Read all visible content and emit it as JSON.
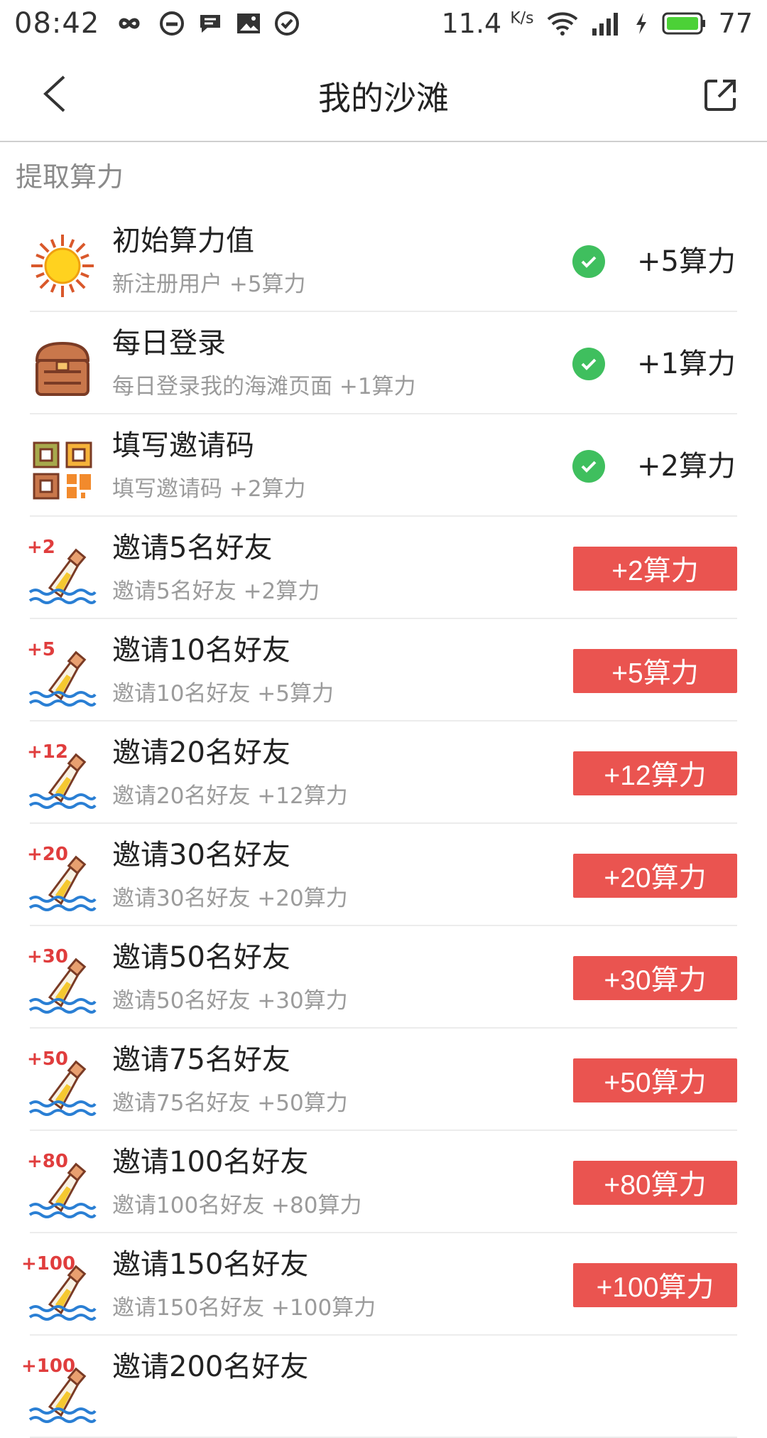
{
  "status_bar": {
    "time": "08:42",
    "speed": "11.4",
    "speed_unit": "K/s",
    "battery": "77",
    "icons": [
      "infinity-icon",
      "face-icon",
      "message-icon",
      "image-icon",
      "check-circle-icon",
      "wifi-icon",
      "signal-icon",
      "charging-icon",
      "battery-icon"
    ]
  },
  "appbar": {
    "title": "我的沙滩"
  },
  "section_title": "提取算力",
  "colors": {
    "accent": "#ea5450",
    "check": "#3fbf5e"
  },
  "items": [
    {
      "icon": "sun-icon",
      "name": "初始算力值",
      "desc": "新注册用户 +5算力",
      "value": "+5算力",
      "status": "done"
    },
    {
      "icon": "treasure-chest-icon",
      "name": "每日登录",
      "desc": "每日登录我的海滩页面 +1算力",
      "value": "+1算力",
      "status": "done"
    },
    {
      "icon": "qr-code-icon",
      "name": "填写邀请码",
      "desc": "填写邀请码 +2算力",
      "value": "+2算力",
      "status": "done"
    },
    {
      "icon": "bottle-icon",
      "badge": "+2",
      "name": "邀请5名好友",
      "desc": "邀请5名好友 +2算力",
      "value": "+2算力",
      "status": "claim"
    },
    {
      "icon": "bottle-icon",
      "badge": "+5",
      "name": "邀请10名好友",
      "desc": "邀请10名好友 +5算力",
      "value": "+5算力",
      "status": "claim"
    },
    {
      "icon": "bottle-icon",
      "badge": "+12",
      "name": "邀请20名好友",
      "desc": "邀请20名好友 +12算力",
      "value": "+12算力",
      "status": "claim"
    },
    {
      "icon": "bottle-icon",
      "badge": "+20",
      "name": "邀请30名好友",
      "desc": "邀请30名好友 +20算力",
      "value": "+20算力",
      "status": "claim"
    },
    {
      "icon": "bottle-icon",
      "badge": "+30",
      "name": "邀请50名好友",
      "desc": "邀请50名好友 +30算力",
      "value": "+30算力",
      "status": "claim"
    },
    {
      "icon": "bottle-icon",
      "badge": "+50",
      "name": "邀请75名好友",
      "desc": "邀请75名好友 +50算力",
      "value": "+50算力",
      "status": "claim"
    },
    {
      "icon": "bottle-icon",
      "badge": "+80",
      "name": "邀请100名好友",
      "desc": "邀请100名好友 +80算力",
      "value": "+80算力",
      "status": "claim"
    },
    {
      "icon": "bottle-icon",
      "badge": "+100",
      "name": "邀请150名好友",
      "desc": "邀请150名好友 +100算力",
      "value": "+100算力",
      "status": "claim"
    },
    {
      "icon": "bottle-icon",
      "badge": "+100",
      "name": "邀请200名好友",
      "desc": "",
      "value": "",
      "status": "claim"
    }
  ]
}
